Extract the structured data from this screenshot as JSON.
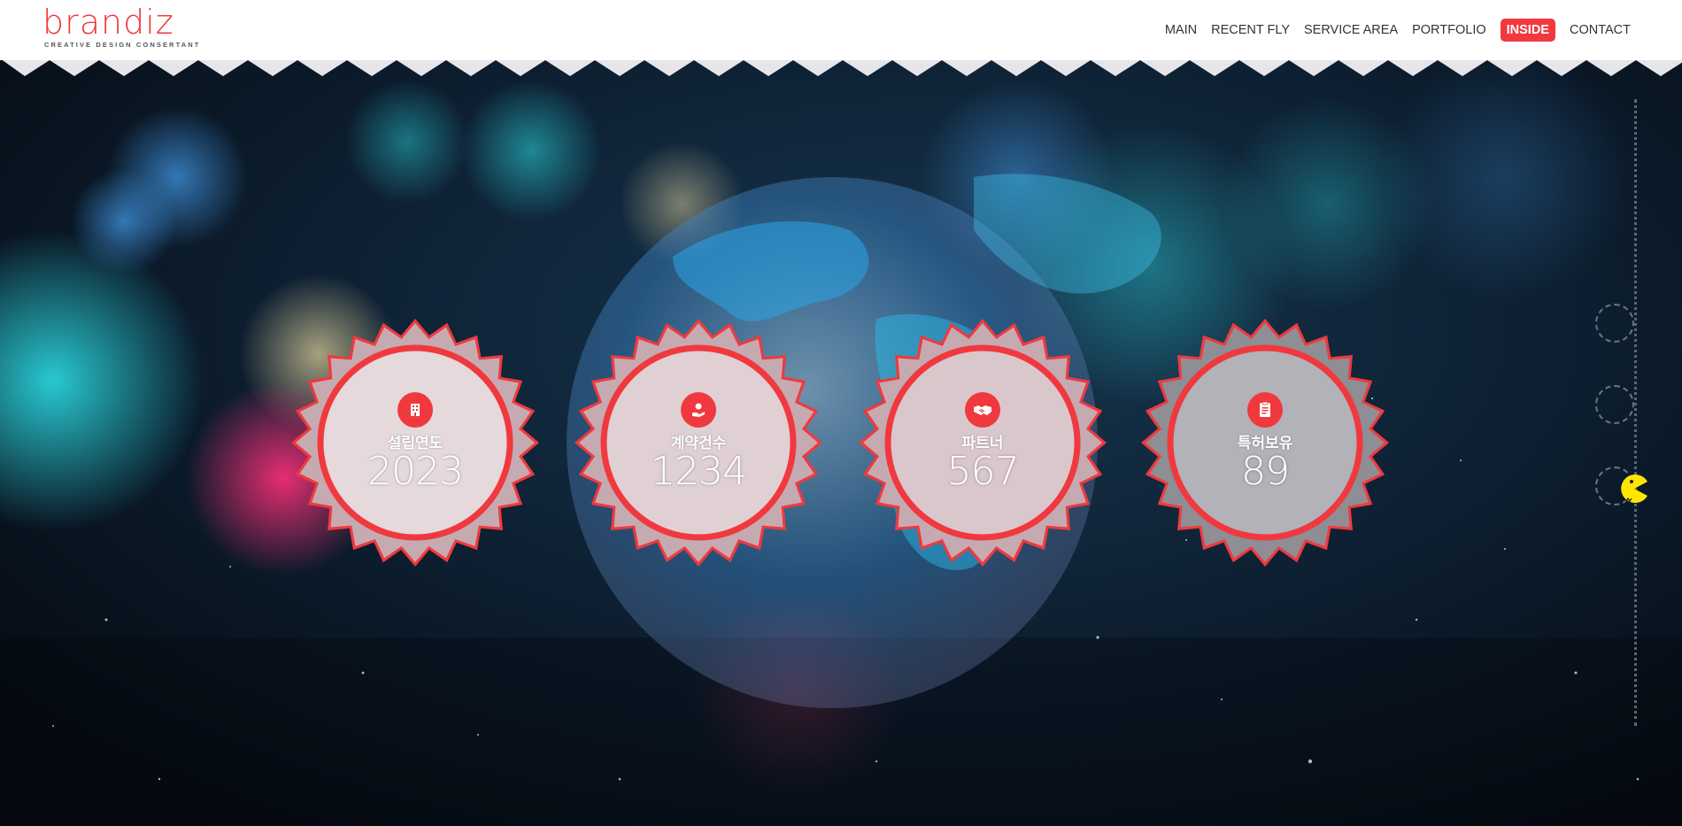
{
  "header": {
    "logo_text": "brandiz",
    "logo_tagline": "CREATIVE DESIGN CONSERTANT",
    "nav": [
      {
        "label": "MAIN",
        "active": false
      },
      {
        "label": "RECENT FLY",
        "active": false
      },
      {
        "label": "SERVICE AREA",
        "active": false
      },
      {
        "label": "PORTFOLIO",
        "active": false
      },
      {
        "label": "INSIDE",
        "active": true
      },
      {
        "label": "CONTACT",
        "active": false
      }
    ]
  },
  "stats": [
    {
      "label": "설립연도",
      "value": "2023",
      "icon": "building-icon"
    },
    {
      "label": "계약건수",
      "value": "1234",
      "icon": "hand-money-icon"
    },
    {
      "label": "파트너",
      "value": "567",
      "icon": "handshake-icon"
    },
    {
      "label": "특허보유",
      "value": "89",
      "icon": "document-icon"
    }
  ],
  "side_nav": {
    "dots": 3,
    "current_icon": "pacman-icon"
  },
  "colors": {
    "accent": "#f0393e",
    "header_bg": "#ffffff",
    "badge_fill": "#b9b9be",
    "pacman": "#ffe600"
  }
}
